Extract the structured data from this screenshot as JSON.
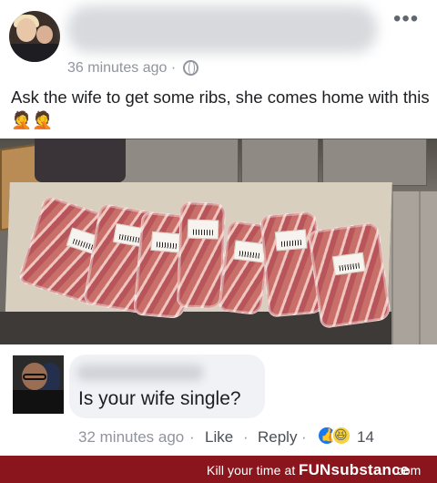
{
  "post": {
    "timestamp": "36 minutes ago ·",
    "text": "Ask the wife to get some ribs, she comes home with this 🤦🤦",
    "more_icon": "more-dots-icon",
    "privacy_icon": "globe-icon"
  },
  "comment": {
    "text": "Is your wife single?",
    "timestamp": "32 minutes ago",
    "separator": "·",
    "like_label": "Like",
    "reply_label": "Reply",
    "reaction_count": "14",
    "reactions": [
      "like-reaction-icon",
      "haha-reaction-icon"
    ]
  },
  "footer": {
    "tagline": "Kill your time at",
    "brand": "FUNsubstance",
    "domain": ".com"
  },
  "colors": {
    "link_text": "#4b4f56",
    "meta_text": "#90949c",
    "footer_bg": "#8b151d",
    "facebook_blue": "#1877f2"
  }
}
